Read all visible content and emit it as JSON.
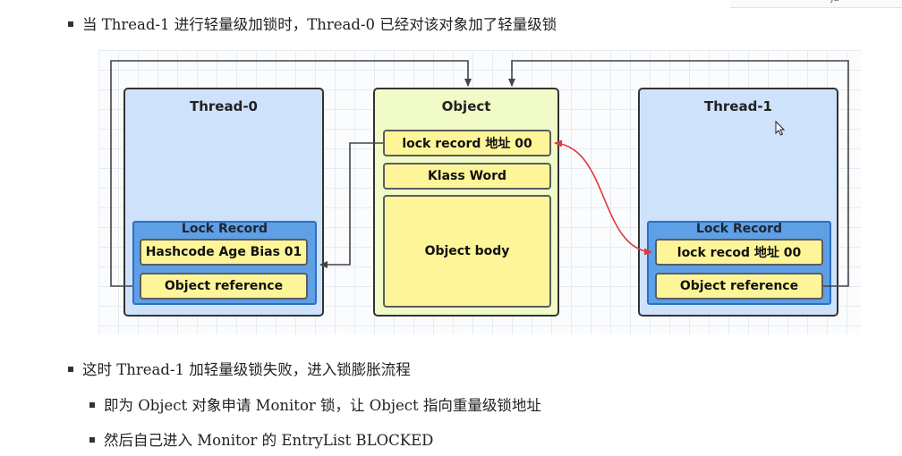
{
  "bullets": {
    "line1": "当 Thread-1 进行轻量级加锁时，Thread-0 已经对该对象加了轻量级锁",
    "line2": "这时 Thread-1 加轻量级锁失败，进入锁膨胀流程",
    "line3": "即为 Object 对象申请 Monitor 锁，让 Object 指向重量级锁地址",
    "line4": "然后自己进入 Monitor 的 EntryList BLOCKED"
  },
  "corner_fragment": "ja",
  "diagram": {
    "thread0": {
      "title": "Thread-0",
      "lock_record_title": "Lock Record",
      "cell1": "Hashcode Age Bias 01",
      "cell2": "Object reference"
    },
    "object": {
      "title": "Object",
      "cell1": "lock  record 地址 00",
      "cell2": "Klass Word",
      "cell3": "Object body"
    },
    "thread1": {
      "title": "Thread-1",
      "lock_record_title": "Lock Record",
      "cell1": "lock recod 地址 00",
      "cell2": "Object reference"
    },
    "colors": {
      "thread_fill": "#cfe2fb",
      "object_fill": "#f1fbc7",
      "lock_record_fill": "#5e9fe5",
      "cell_fill": "#fdf598",
      "red_arrow": "#e0393e",
      "connector": "#444444"
    }
  }
}
